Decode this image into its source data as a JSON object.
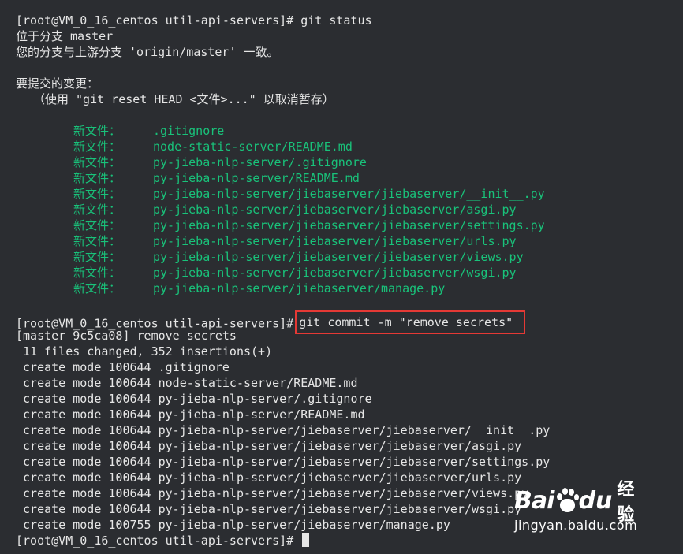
{
  "prompt": "[root@VM_0_16_centos util-api-servers]#",
  "status_section": {
    "command": "git status",
    "branch_line": "位于分支 master",
    "sync_line": "您的分支与上游分支 'origin/master' 一致。",
    "changes_header": "要提交的变更：",
    "hint": "（使用 \"git reset HEAD <文件>...\" 以取消暂存）",
    "new_file_label": "新文件：",
    "staged_files": [
      ".gitignore",
      "node-static-server/README.md",
      "py-jieba-nlp-server/.gitignore",
      "py-jieba-nlp-server/README.md",
      "py-jieba-nlp-server/jiebaserver/jiebaserver/__init__.py",
      "py-jieba-nlp-server/jiebaserver/jiebaserver/asgi.py",
      "py-jieba-nlp-server/jiebaserver/jiebaserver/settings.py",
      "py-jieba-nlp-server/jiebaserver/jiebaserver/urls.py",
      "py-jieba-nlp-server/jiebaserver/jiebaserver/views.py",
      "py-jieba-nlp-server/jiebaserver/jiebaserver/wsgi.py",
      "py-jieba-nlp-server/jiebaserver/manage.py"
    ]
  },
  "commit_section": {
    "command": "git commit -m \"remove secrets\"",
    "result_line": "[master 9c5ca08] remove secrets",
    "summary_line": " 11 files changed, 352 insertions(+)",
    "create_lines": [
      " create mode 100644 .gitignore",
      " create mode 100644 node-static-server/README.md",
      " create mode 100644 py-jieba-nlp-server/.gitignore",
      " create mode 100644 py-jieba-nlp-server/README.md",
      " create mode 100644 py-jieba-nlp-server/jiebaserver/jiebaserver/__init__.py",
      " create mode 100644 py-jieba-nlp-server/jiebaserver/jiebaserver/asgi.py",
      " create mode 100644 py-jieba-nlp-server/jiebaserver/jiebaserver/settings.py",
      " create mode 100644 py-jieba-nlp-server/jiebaserver/jiebaserver/urls.py",
      " create mode 100644 py-jieba-nlp-server/jiebaserver/jiebaserver/views.py",
      " create mode 100644 py-jieba-nlp-server/jiebaserver/jiebaserver/wsgi.py",
      " create mode 100755 py-jieba-nlp-server/jiebaserver/manage.py"
    ]
  },
  "watermark": {
    "brand_left": "Bai",
    "brand_right": "du",
    "product": "经验",
    "url": "jingyan.baidu.com"
  },
  "colors": {
    "background": "#2b2d31",
    "text": "#e6e6e6",
    "staged_green": "#19c27a",
    "highlight_red": "#e53935"
  }
}
